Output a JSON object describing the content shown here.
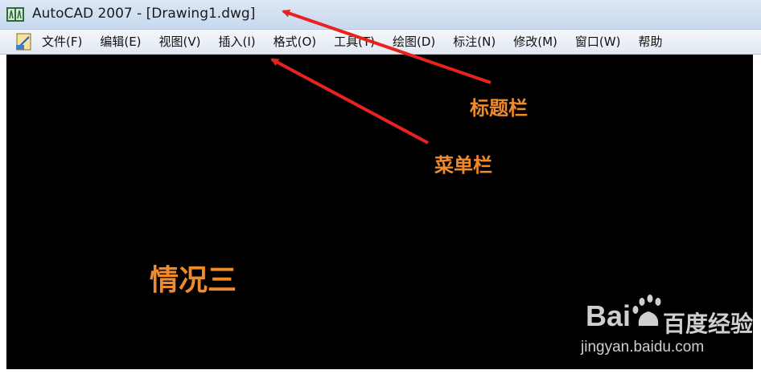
{
  "window": {
    "title": "AutoCAD 2007 - [Drawing1.dwg]",
    "app_icon": "autocad-icon"
  },
  "menubar": {
    "doc_icon": "drawing-document-icon",
    "items": [
      {
        "label": "文件(F)"
      },
      {
        "label": "编辑(E)"
      },
      {
        "label": "视图(V)"
      },
      {
        "label": "插入(I)"
      },
      {
        "label": "格式(O)"
      },
      {
        "label": "工具(T)"
      },
      {
        "label": "绘图(D)"
      },
      {
        "label": "标注(N)"
      },
      {
        "label": "修改(M)"
      },
      {
        "label": "窗口(W)"
      },
      {
        "label": "帮助"
      }
    ]
  },
  "canvas": {
    "background_color": "#000000"
  },
  "annotations": {
    "title_bar_label": "标题栏",
    "menu_bar_label": "菜单栏",
    "case_label": "情况三",
    "label_color": "#f08a2c",
    "arrow_color": "#e8231f"
  },
  "watermark": {
    "brand": "Bai",
    "brand_suffix": "百度经验",
    "url": "jingyan.baidu.com"
  }
}
